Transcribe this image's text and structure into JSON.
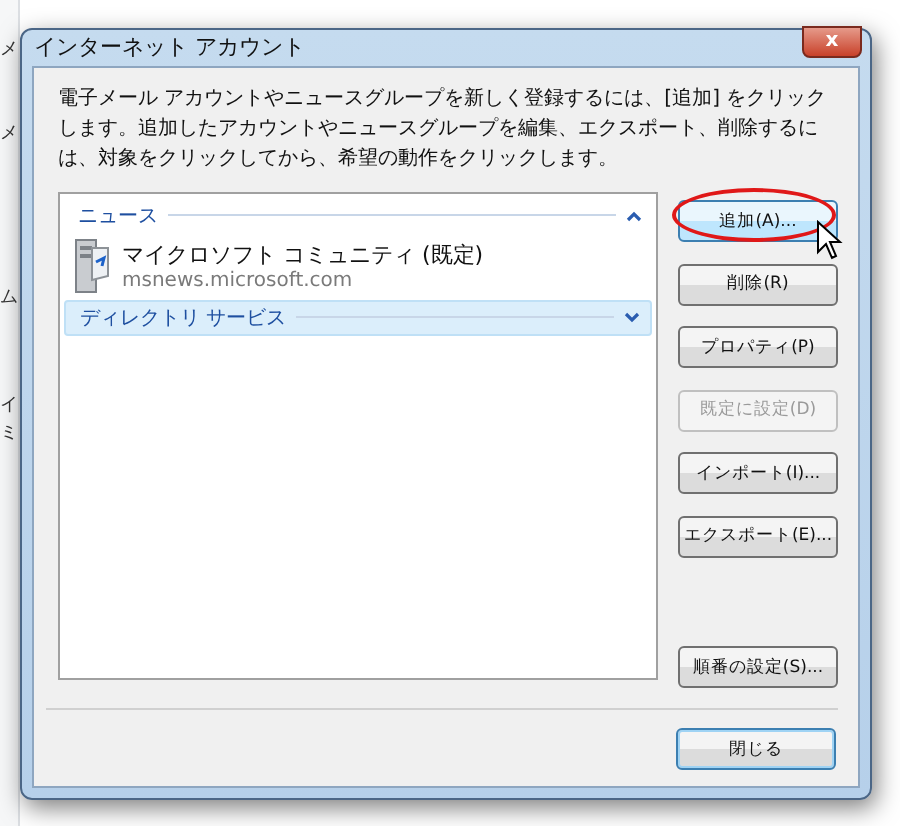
{
  "background_window": {
    "fragments": [
      "メ",
      "メ",
      "ム",
      "イ",
      "ミ"
    ]
  },
  "window": {
    "title": "インターネット アカウント",
    "close_label": "x"
  },
  "description": "電子メール アカウントやニュースグループを新しく登録するには、[追加] をクリックします。追加したアカウントやニュースグループを編集、エクスポート、削除するには、対象をクリックしてから、希望の動作をクリックします。",
  "groups": [
    {
      "label": "ニュース",
      "expanded": true,
      "selected": false,
      "items": [
        {
          "name": "マイクロソフト コミュニティ (既定)",
          "server": "msnews.microsoft.com"
        }
      ]
    },
    {
      "label": "ディレクトリ サービス",
      "expanded": false,
      "selected": true
    }
  ],
  "buttons": [
    {
      "label": "追加(A)...",
      "disabled": false,
      "highlighted": true,
      "hovered": true
    },
    {
      "label": "削除(R)",
      "disabled": false,
      "highlighted": false,
      "hovered": false
    },
    {
      "label": "プロパティ(P)",
      "disabled": false,
      "highlighted": false,
      "hovered": false
    },
    {
      "label": "既定に設定(D)",
      "disabled": true,
      "highlighted": false,
      "hovered": false
    },
    {
      "label": "インポート(I)...",
      "disabled": false,
      "highlighted": false,
      "hovered": false
    },
    {
      "label": "エクスポート(E)...",
      "disabled": false,
      "highlighted": false,
      "hovered": false
    },
    {
      "label": "順番の設定(S)...",
      "disabled": false,
      "highlighted": false,
      "hovered": false
    }
  ],
  "close_button": {
    "label": "閉じる",
    "default": true
  }
}
